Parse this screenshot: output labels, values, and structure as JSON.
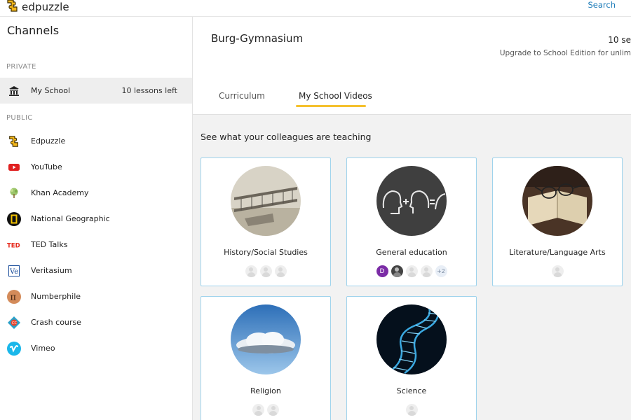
{
  "app": {
    "logo_text": "edpuzzle",
    "search_label": "Search",
    "accent_color": "#f5c12e",
    "link_color": "#1a7ab8"
  },
  "sidebar": {
    "title": "Channels",
    "private_label": "PRIVATE",
    "public_label": "PUBLIC",
    "private_items": [
      {
        "label": "My School",
        "meta": "10 lessons left",
        "icon": "school-building-icon"
      }
    ],
    "public_items": [
      {
        "label": "Edpuzzle",
        "icon": "edpuzzle-logo-icon"
      },
      {
        "label": "YouTube",
        "icon": "youtube-icon"
      },
      {
        "label": "Khan Academy",
        "icon": "khan-academy-tree-icon"
      },
      {
        "label": "National Geographic",
        "icon": "national-geographic-icon"
      },
      {
        "label": "TED Talks",
        "icon": "ted-icon"
      },
      {
        "label": "Veritasium",
        "icon": "veritasium-icon"
      },
      {
        "label": "Numberphile",
        "icon": "numberphile-pi-icon"
      },
      {
        "label": "Crash course",
        "icon": "crash-course-icon"
      },
      {
        "label": "Vimeo",
        "icon": "vimeo-icon"
      }
    ]
  },
  "header": {
    "school_name": "Burg-Gymnasium",
    "seats_text": "10 se",
    "upgrade_text": "Upgrade to School Edition for unlim",
    "tabs": [
      {
        "label": "Curriculum",
        "active": false
      },
      {
        "label": "My School Videos",
        "active": true
      }
    ]
  },
  "main": {
    "heading": "See what your colleagues are teaching",
    "cards": [
      {
        "title": "History/Social Studies",
        "image": "wright-flyer-photo",
        "avatar_count": 3
      },
      {
        "title": "General education",
        "image": "chalkboard-heads-photo",
        "avatar_letter": "D",
        "avatar_count": 2,
        "more": "+2"
      },
      {
        "title": "Literature/Language Arts",
        "image": "book-glasses-photo",
        "avatar_count": 1
      },
      {
        "title": "Religion",
        "image": "sky-clouds-photo",
        "avatar_count": 2
      },
      {
        "title": "Science",
        "image": "dna-helix-photo",
        "avatar_count": 1
      }
    ]
  }
}
